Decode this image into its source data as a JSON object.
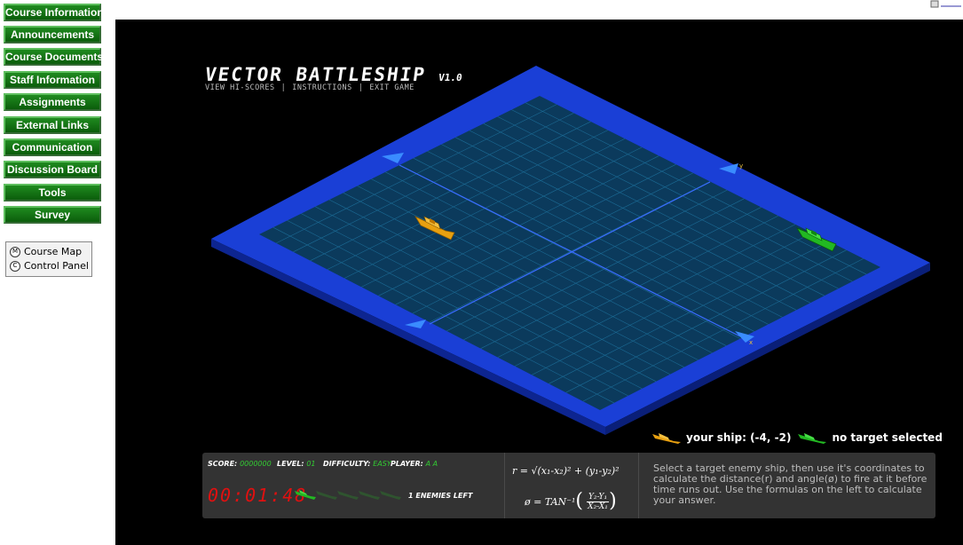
{
  "nav": [
    {
      "label": "Course Information"
    },
    {
      "label": "Announcements"
    },
    {
      "label": "Course Documents"
    },
    {
      "label": "Staff Information"
    },
    {
      "label": "Assignments"
    },
    {
      "label": "External Links"
    },
    {
      "label": "Communication"
    },
    {
      "label": "Discussion Board"
    },
    {
      "label": "Tools"
    },
    {
      "label": "Survey"
    }
  ],
  "toolbox": {
    "course_map": "Course Map",
    "control_panel": "Control Panel"
  },
  "game": {
    "title": "VECTOR BATTLESHIP",
    "version": "V1.0",
    "menu": {
      "hiscores": "VIEW HI-SCORES",
      "separator": "|",
      "instructions": "INSTRUCTIONS",
      "exit": "EXIT GAME"
    },
    "legend": {
      "your_ship": "your ship: (-4, -2)",
      "target": "no target selected"
    },
    "hud": {
      "score_label": "SCORE:",
      "score_value": "0000000",
      "level_label": "LEVEL:",
      "level_value": "01",
      "difficulty_label": "DIFFICULTY:",
      "difficulty_value": "EASY",
      "player_label": "PLAYER:",
      "player_value": "A A",
      "timer": "00:01:48",
      "enemies_left": "1 ENEMIES LEFT",
      "formula_r": "r = √(x₁-x₂)² + (y₁-y₂)²",
      "formula_angle_prefix": "ø = TAN⁻¹",
      "formula_num": "Y₂-Y₁",
      "formula_den": "X₂-X₁",
      "instructions": "Select a target enemy ship, then use it's coordinates to calculate the distance(r) and angle(ø) to fire at it before time runs out. Use the formulas on the left to calculate your answer."
    },
    "colors": {
      "board_frame": "#1a3fd6",
      "grid_water": "#0b3a5c",
      "player_ship": "#e8a010",
      "enemy_ship": "#22b822",
      "timer": "#e01010"
    }
  }
}
